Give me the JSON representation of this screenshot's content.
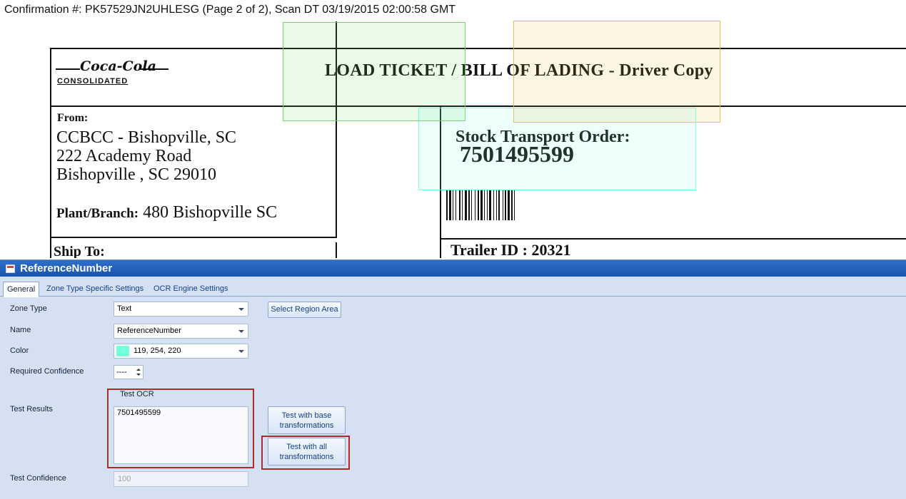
{
  "viewer": {
    "confirmation": "Confirmation #: PK57529JN2UHLESG (Page 2 of 2), Scan DT 03/19/2015 02:00:58 GMT",
    "document": {
      "logo_script": "Coca-Cola",
      "logo_word": "CONSOLIDATED",
      "title": "LOAD TICKET / BILL OF LADING  -  Driver Copy",
      "from_label": "From:",
      "from_lines": [
        "CCBCC - Bishopville, SC",
        "222 Academy Road",
        "Bishopville , SC  29010"
      ],
      "plant_label": "Plant/Branch:",
      "plant_value": "480  Bishopville SC",
      "ship_to": "Ship To:",
      "sto_label": "Stock Transport Order:",
      "sto_number": "7501495599",
      "trailer": "Trailer ID : 20321"
    },
    "zone_colors": {
      "green": "#6fd25a",
      "yellow": "#e8b840",
      "cyan": "#77fedc"
    }
  },
  "dialog": {
    "title": "ReferenceNumber",
    "tabs": [
      "General",
      "Zone Type Specific Settings",
      "OCR Engine Settings"
    ],
    "active_tab": "General",
    "labels": {
      "zone_type": "Zone Type",
      "name": "Name",
      "color": "Color",
      "required_confidence": "Required Confidence",
      "test_results": "Test Results",
      "test_confidence": "Test Confidence"
    },
    "zone_type_value": "Text",
    "name_value": "ReferenceNumber",
    "color_value": "119, 254, 220",
    "color_hex": "#77fedc",
    "required_confidence_value": "----",
    "select_region_button": "Select Region Area",
    "test_ocr_label": "Test OCR",
    "test_result_value": "7501495599",
    "test_base_button": "Test with base transformations",
    "test_all_button": "Test with all transformations",
    "test_confidence_placeholder": "100"
  }
}
